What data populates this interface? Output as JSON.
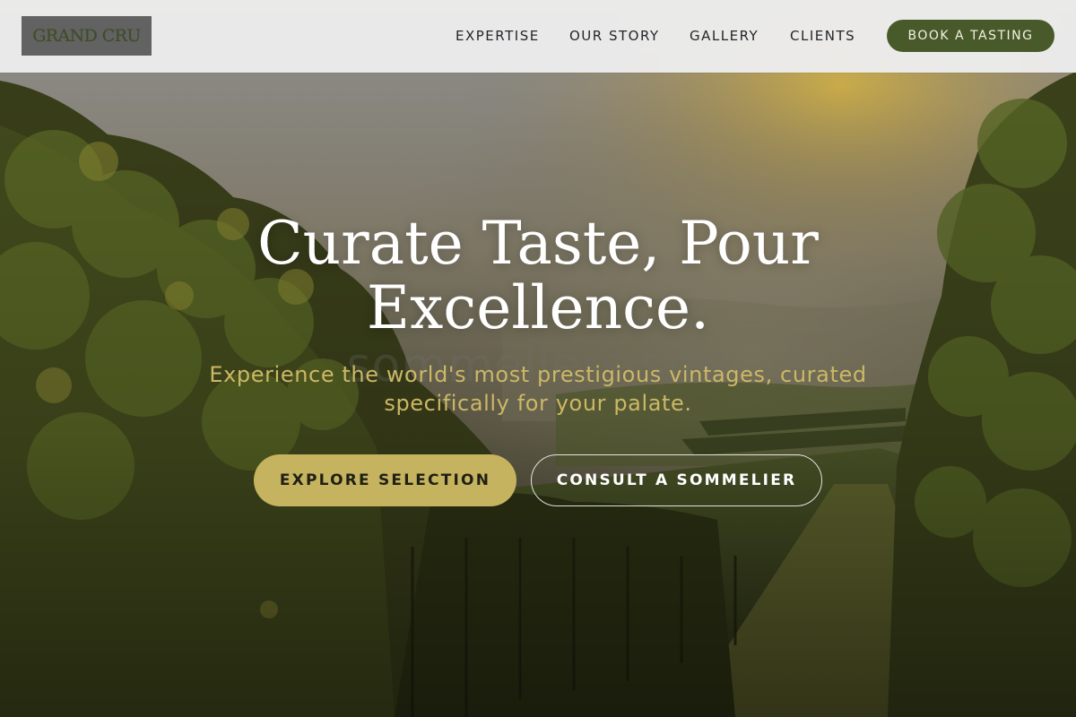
{
  "brand": {
    "logo_text": "GRAND CRU"
  },
  "nav": {
    "links": [
      "EXPERTISE",
      "OUR STORY",
      "GALLERY",
      "CLIENTS"
    ],
    "cta_label": "BOOK A TASTING"
  },
  "hero": {
    "title_line1": "Curate Taste, Pour",
    "title_line2": "Excellence.",
    "subtitle_line1": "Experience the world's most prestigious vintages, curated",
    "subtitle_line2": "specifically for your palate.",
    "watermark": "sommeliers.site",
    "primary_button": "EXPLORE SELECTION",
    "secondary_button": "CONSULT A SOMMELIER",
    "background": "vineyard-rows-photo"
  },
  "colors": {
    "accent_olive": "#495a2a",
    "accent_gold": "#c5b35f",
    "header_bg": "#ececec"
  }
}
